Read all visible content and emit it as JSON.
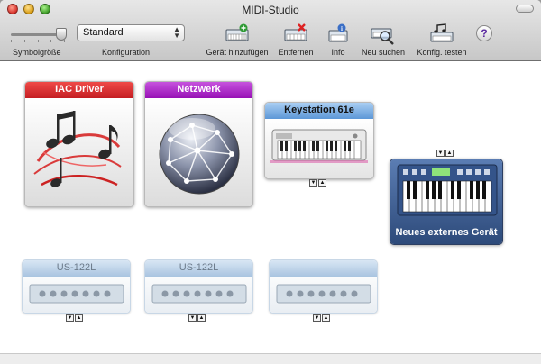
{
  "window": {
    "title": "MIDI-Studio"
  },
  "toolbar": {
    "icon_size_label": "Symbolgröße",
    "config_label": "Konfiguration",
    "config_value": "Standard",
    "tools": [
      {
        "label": "Gerät hinzufügen",
        "icon": "add-device-icon"
      },
      {
        "label": "Entfernen",
        "icon": "remove-device-icon"
      },
      {
        "label": "Info",
        "icon": "info-icon"
      },
      {
        "label": "Neu suchen",
        "icon": "rescan-icon"
      },
      {
        "label": "Konfig. testen",
        "icon": "test-config-icon"
      },
      {
        "label": "?",
        "icon": "help-icon"
      }
    ]
  },
  "devices": [
    {
      "name": "IAC Driver",
      "color": "#d8262b",
      "icon": "music-notes-icon"
    },
    {
      "name": "Netzwerk",
      "color": "#a81cc6",
      "icon": "network-globe-icon"
    },
    {
      "name": "Keystation 61e",
      "color": "#4f8ed4",
      "icon": "keyboard-icon"
    },
    {
      "name": "Neues externes Gerät",
      "color": "#3c5d8f",
      "icon": "synthesizer-icon"
    },
    {
      "name": "US-122L",
      "color": "#b5cde4",
      "icon": "interface-icon"
    },
    {
      "name": "US-122L",
      "color": "#b5cde4",
      "icon": "interface-icon"
    },
    {
      "name": "",
      "color": "#b5cde4",
      "icon": "interface-icon"
    }
  ],
  "colors": {
    "accent_red": "#d8262b",
    "accent_purple": "#a81cc6",
    "accent_blue": "#4f8ed4",
    "offline_blue": "#b5cde4"
  }
}
